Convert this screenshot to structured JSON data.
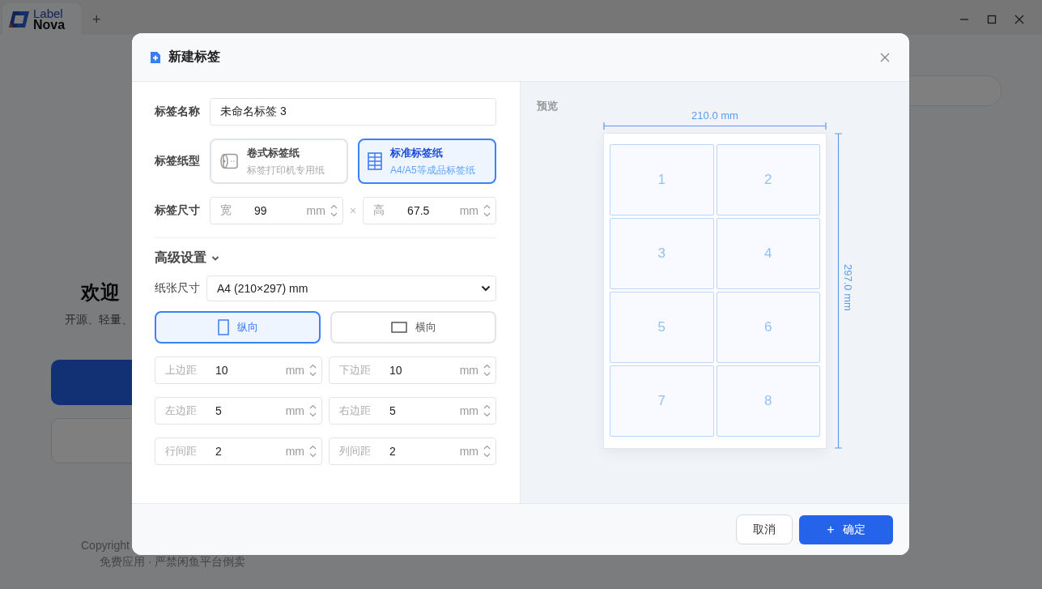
{
  "app": {
    "logo": {
      "line1": "Label",
      "line2": "Nova"
    },
    "new_tab": "+"
  },
  "background": {
    "heading": "欢迎",
    "subtitle": "开源、轻量、",
    "copyright": "Copyright",
    "notice": "免费应用 · 严禁闲鱼平台倒卖"
  },
  "dialog": {
    "title": "新建标签",
    "name": {
      "label": "标签名称",
      "value": "未命名标签 3"
    },
    "paper_type": {
      "label": "标签纸型",
      "options": [
        {
          "kind": "roll",
          "title": "卷式标签纸",
          "subtitle": "标签打印机专用纸",
          "selected": false
        },
        {
          "kind": "sheet",
          "title": "标准标签纸",
          "subtitle": "A4/A5等成品标签纸",
          "selected": true
        }
      ]
    },
    "size": {
      "label": "标签尺寸",
      "separator": "×",
      "fields": [
        {
          "prefix": "宽",
          "value": "99",
          "unit": "mm"
        },
        {
          "prefix": "高",
          "value": "67.5",
          "unit": "mm"
        }
      ]
    },
    "advanced": {
      "title": "高级设置",
      "expanded": true,
      "paper_size": {
        "label": "纸张尺寸",
        "value": "A4 (210×297) mm"
      },
      "orientations": [
        {
          "kind": "portrait",
          "label": "纵向",
          "selected": true
        },
        {
          "kind": "landscape",
          "label": "横向",
          "selected": false
        }
      ],
      "spacing": [
        {
          "label": "上边距",
          "value": "10",
          "unit": "mm"
        },
        {
          "label": "下边距",
          "value": "10",
          "unit": "mm"
        },
        {
          "label": "左边距",
          "value": "5",
          "unit": "mm"
        },
        {
          "label": "右边距",
          "value": "5",
          "unit": "mm"
        },
        {
          "label": "行间距",
          "value": "2",
          "unit": "mm"
        },
        {
          "label": "列间距",
          "value": "2",
          "unit": "mm"
        }
      ]
    }
  },
  "preview": {
    "label": "预览",
    "width_label": "210.0 mm",
    "height_label": "297.0 mm",
    "cells": [
      "1",
      "2",
      "3",
      "4",
      "5",
      "6",
      "7",
      "8"
    ]
  },
  "buttons": {
    "cancel": "取消",
    "confirm": {
      "icon": "+",
      "label": "确定"
    }
  }
}
